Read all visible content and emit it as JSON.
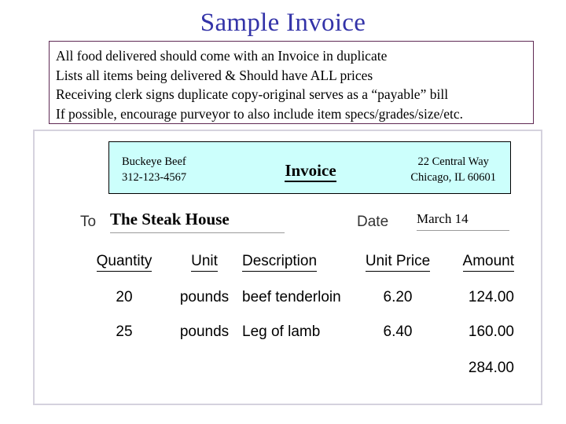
{
  "slide": {
    "title": "Sample Invoice"
  },
  "notes": {
    "lines": [
      "All food delivered should come with an Invoice in duplicate",
      "Lists all items being delivered & Should have ALL prices",
      "Receiving clerk signs duplicate copy-original serves as a “payable” bill",
      "If possible, encourage purveyor to also include item specs/grades/size/etc."
    ]
  },
  "invoice": {
    "letterhead": {
      "company_name": "Buckeye Beef",
      "phone": "312-123-4567",
      "heading": "Invoice",
      "address_line1": "22 Central Way",
      "address_line2": "Chicago, IL  60601"
    },
    "to": {
      "label": "To",
      "value": "The Steak House"
    },
    "date": {
      "label": "Date",
      "value": "March 14"
    },
    "table": {
      "headers": [
        "Quantity",
        "Unit",
        "Description",
        "Unit Price",
        "Amount"
      ],
      "rows": [
        {
          "quantity": "20",
          "unit": "pounds",
          "description": "beef tenderloin",
          "unit_price": "6.20",
          "amount": "124.00"
        },
        {
          "quantity": "25",
          "unit": "pounds",
          "description": "Leg of lamb",
          "unit_price": "6.40",
          "amount": "160.00"
        }
      ],
      "total": "284.00"
    }
  },
  "colors": {
    "title_blue": "#3333a8",
    "notes_border": "#5f2a54",
    "letterhead_fill": "#ccfffc",
    "card_border": "#d5d2de"
  }
}
